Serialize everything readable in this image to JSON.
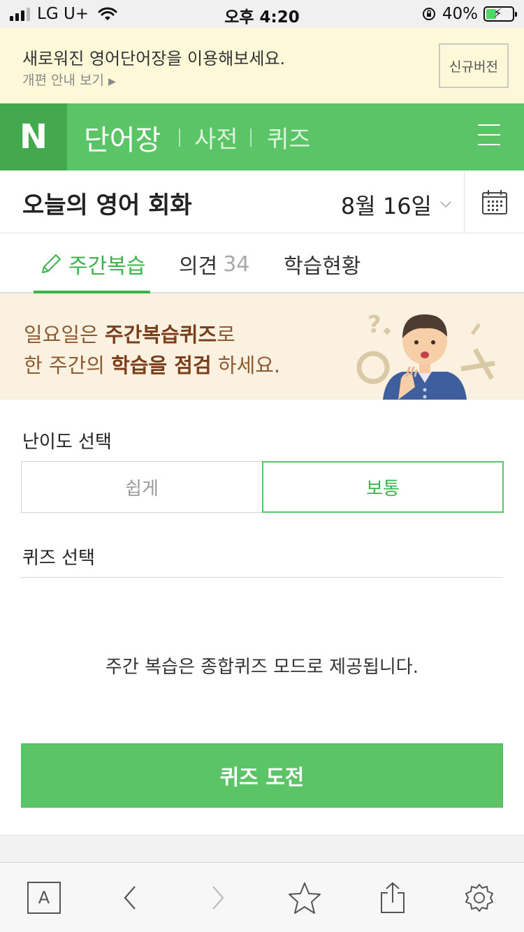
{
  "status_bar": {
    "carrier": "LG U+",
    "time": "오후 4:20",
    "battery_percent": "40%",
    "battery_level": 0.4
  },
  "notice": {
    "title": "새로워진 영어단어장을 이용해보세요.",
    "link": "개편 안내 보기",
    "button": "신규버전"
  },
  "header": {
    "logo": "N",
    "nav_active": "단어장",
    "nav_items": [
      "사전",
      "퀴즈"
    ]
  },
  "title_row": {
    "title": "오늘의 영어 회화",
    "date": "8월 16일"
  },
  "tabs": [
    {
      "label": "주간복습",
      "active": true
    },
    {
      "label": "의견",
      "count": "34"
    },
    {
      "label": "학습현황"
    }
  ],
  "promo": {
    "line1_pre": "일요일은 ",
    "line1_bold": "주간복습퀴즈",
    "line1_post": "로",
    "line2_pre": "한 주간의 ",
    "line2_bold": "학습을 점검",
    "line2_post": " 하세요."
  },
  "quiz": {
    "difficulty_label": "난이도 선택",
    "difficulty_options": [
      "쉽게",
      "보통"
    ],
    "selected_difficulty": "보통",
    "quiz_label": "퀴즈 선택",
    "info": "주간 복습은 종합퀴즈 모드로 제공됩니다.",
    "start_button": "퀴즈 도전"
  },
  "toolbar": {
    "reader_label": "A",
    "icons": [
      "reader-icon",
      "back-icon",
      "forward-icon",
      "star-icon",
      "share-icon",
      "settings-icon"
    ]
  },
  "colors": {
    "brand_green": "#5ac466",
    "logo_green": "#43a84e",
    "notice_bg": "#fdf8d8",
    "promo_bg": "#fbf1e1"
  }
}
